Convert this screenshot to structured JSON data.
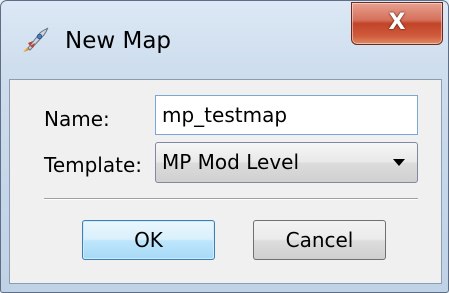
{
  "window": {
    "title": "New Map",
    "icon": "rocket-icon",
    "close_label": "X"
  },
  "form": {
    "name_label": "Name:",
    "name_value": "mp_testmap",
    "template_label": "Template:",
    "template_value": "MP Mod Level"
  },
  "buttons": {
    "ok_label": "OK",
    "cancel_label": "Cancel"
  },
  "colors": {
    "close_button": "#c24428",
    "ok_border": "#3c7fb1",
    "input_border": "#7aa7d6"
  }
}
